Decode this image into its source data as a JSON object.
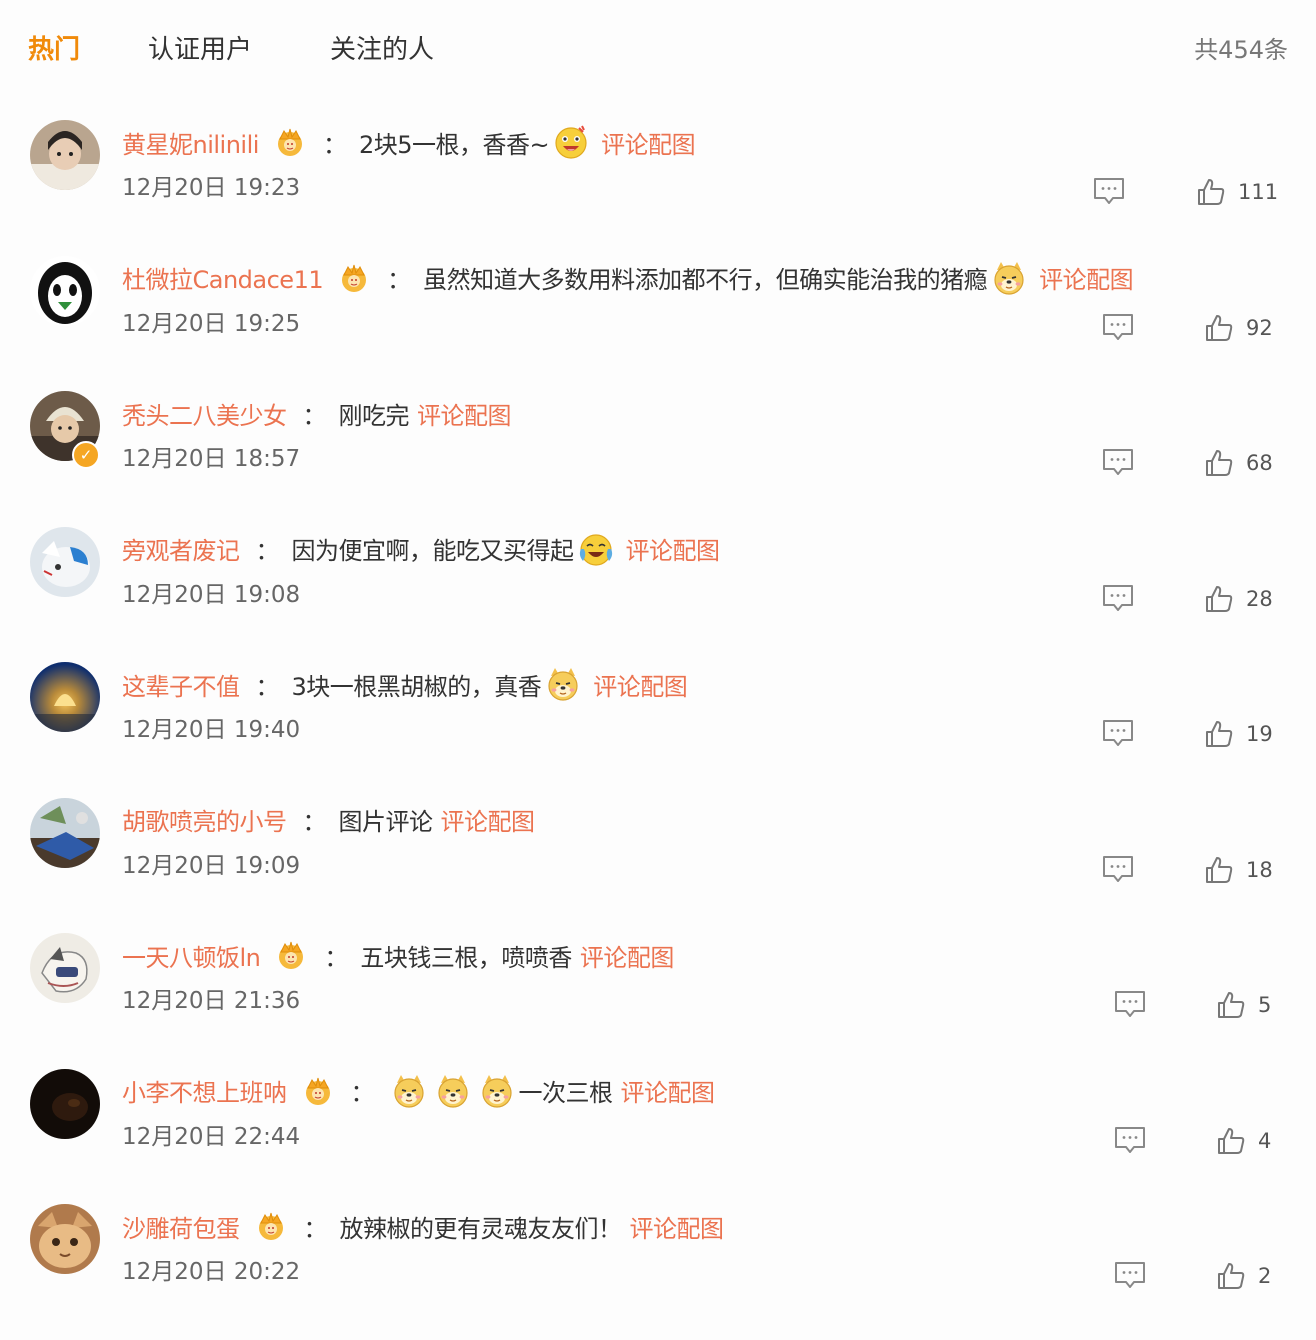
{
  "tabs": [
    {
      "label": "热门"
    },
    {
      "label": "认证用户"
    },
    {
      "label": "关注的人"
    }
  ],
  "total_count": "共454条",
  "link_label": "评论配图",
  "colors": {
    "accent": "#f08a0a",
    "username": "#eb7350"
  },
  "comments": [
    {
      "user": "黄星妮nilinili",
      "text": "2块5一根，香香~",
      "time": "12月20日 19:23",
      "likes": "111",
      "badge": "crown",
      "emoji": "grin"
    },
    {
      "user": "杜微拉Candace11",
      "text": "虽然知道大多数用料添加都不行，但确实能治我的猪瘾",
      "time": "12月20日 19:25",
      "likes": "92",
      "badge": "crown",
      "emoji": "doge"
    },
    {
      "user": "秃头二八美少女",
      "text": "刚吃完",
      "time": "12月20日 18:57",
      "likes": "68",
      "badge": "verified"
    },
    {
      "user": "旁观者废记",
      "text": "因为便宜啊，能吃又买得起",
      "time": "12月20日 19:08",
      "likes": "28",
      "emoji": "laugh-cry"
    },
    {
      "user": "这辈子不值",
      "text": "3块一根黑胡椒的，真香",
      "time": "12月20日 19:40",
      "likes": "19",
      "emoji": "doge"
    },
    {
      "user": "胡歌喷亮的小号",
      "text": "图片评论",
      "time": "12月20日 19:09",
      "likes": "18"
    },
    {
      "user": "一天八顿饭ln",
      "text": "五块钱三根，喷喷香",
      "time": "12月20日 21:36",
      "likes": "5",
      "badge": "crown"
    },
    {
      "user": "小李不想上班呐",
      "text": "一次三根",
      "time": "12月20日 22:44",
      "likes": "4",
      "badge": "crown",
      "lead_emojis": [
        "doge",
        "doge",
        "doge"
      ]
    },
    {
      "user": "沙雕荷包蛋",
      "text": "放辣椒的更有灵魂友友们！",
      "time": "12月20日 20:22",
      "likes": "2",
      "badge": "crown"
    }
  ]
}
